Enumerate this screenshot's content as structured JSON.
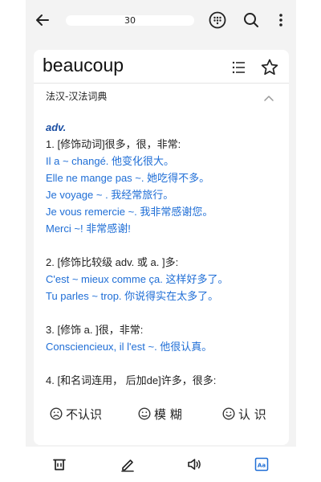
{
  "header": {
    "progress_text": "30"
  },
  "entry": {
    "word": "beaucoup",
    "dictionary": "法汉-汉法词典"
  },
  "definition": {
    "pos": "adv.",
    "lines": [
      {
        "kind": "sense",
        "text": "1. [修饰动词]很多，很，非常:"
      },
      {
        "kind": "ex",
        "text": "Il a ~ changé. 他变化很大。"
      },
      {
        "kind": "ex",
        "text": "Elle ne mange pas ~. 她吃得不多。"
      },
      {
        "kind": "ex",
        "text": "Je voyage ~ . 我经常旅行。"
      },
      {
        "kind": "ex",
        "text": "Je vous remercie ~. 我非常感谢您。"
      },
      {
        "kind": "ex",
        "text": "Merci ~! 非常感谢!"
      },
      {
        "kind": "gap",
        "text": ""
      },
      {
        "kind": "sense",
        "text": "2. [修饰比较级 adv. 或 a. ]多:"
      },
      {
        "kind": "ex",
        "text": "C'est ~ mieux comme ça. 这样好多了。"
      },
      {
        "kind": "ex",
        "text": "Tu parles ~ trop. 你说得实在太多了。"
      },
      {
        "kind": "gap",
        "text": ""
      },
      {
        "kind": "sense",
        "text": "3. [修饰 a. ]很，非常:"
      },
      {
        "kind": "ex",
        "text": "Consciencieux, il l'est ~. 他很认真。"
      },
      {
        "kind": "gap",
        "text": ""
      },
      {
        "kind": "sense",
        "text": "4. [和名词连用， 后加de]许多，很多:"
      }
    ]
  },
  "recognize": {
    "unknown": "不认识",
    "fuzzy": "模 糊",
    "known": "认 识"
  },
  "icons": {
    "back": "arrow-left-icon",
    "keypad": "dialpad-icon",
    "search": "search-icon",
    "more": "more-vertical-icon",
    "list": "list-icon",
    "star": "star-icon",
    "delete": "trash-icon",
    "edit": "pencil-icon",
    "audio": "speaker-icon",
    "font": "font-size-icon"
  },
  "colors": {
    "example_blue": "#1f6ed6",
    "pos_blue": "#1a4ea3",
    "font_icon_blue": "#1f6ed6"
  }
}
